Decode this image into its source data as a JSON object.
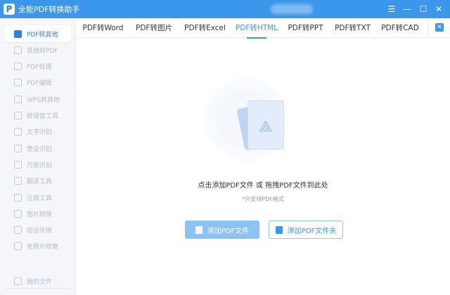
{
  "app": {
    "title": "全能PDF转换助手",
    "logo": "P"
  },
  "window": {
    "menu_icon": "☰",
    "min_icon": "—",
    "max_icon": "☐",
    "close_icon": "✕"
  },
  "sidebar": {
    "items": [
      {
        "label": "PDF转其他"
      },
      {
        "label": "其他转PDF"
      },
      {
        "label": "PDF处理"
      },
      {
        "label": "PDF编辑"
      },
      {
        "label": "WPS转其他"
      },
      {
        "label": "转语音工具"
      },
      {
        "label": "文字识别"
      },
      {
        "label": "票证识别"
      },
      {
        "label": "万能识别"
      },
      {
        "label": "翻译工具"
      },
      {
        "label": "压缩工具"
      },
      {
        "label": "图片转换"
      },
      {
        "label": "拍证件照"
      },
      {
        "label": "老照片修复"
      }
    ],
    "bottom": {
      "label": "我的文件"
    }
  },
  "tabs": [
    {
      "label": "PDF转Word"
    },
    {
      "label": "PDF转图片"
    },
    {
      "label": "PDF转Excel"
    },
    {
      "label": "PDF转HTML"
    },
    {
      "label": "PDF转PPT"
    },
    {
      "label": "PDF转TXT"
    },
    {
      "label": "PDF转CAD"
    }
  ],
  "main": {
    "drop_hint": "点击添加PDF文件 或 拖拽PDF文件到此处",
    "support_note": "*只支持PDF格式",
    "add_file": "添加PDF文件",
    "add_folder": "添加PDF文件夹"
  },
  "colors": {
    "accent": "#3b97ea"
  }
}
